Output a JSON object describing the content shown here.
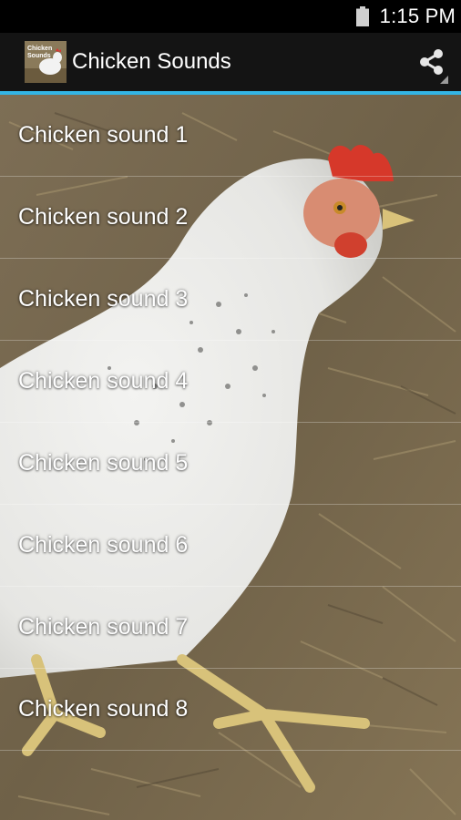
{
  "status_bar": {
    "time": "1:15 PM",
    "battery_icon": "battery-icon"
  },
  "action_bar": {
    "icon_text_line1": "Chicken",
    "icon_text_line2": "Sounds",
    "title": "Chicken Sounds",
    "share_icon": "share-icon",
    "accent_color": "#33b5e5"
  },
  "sounds": [
    {
      "label": "Chicken sound 1"
    },
    {
      "label": "Chicken sound 2"
    },
    {
      "label": "Chicken sound 3"
    },
    {
      "label": "Chicken sound 4"
    },
    {
      "label": "Chicken sound 5"
    },
    {
      "label": "Chicken sound 6"
    },
    {
      "label": "Chicken sound 7"
    },
    {
      "label": "Chicken sound 8"
    }
  ]
}
